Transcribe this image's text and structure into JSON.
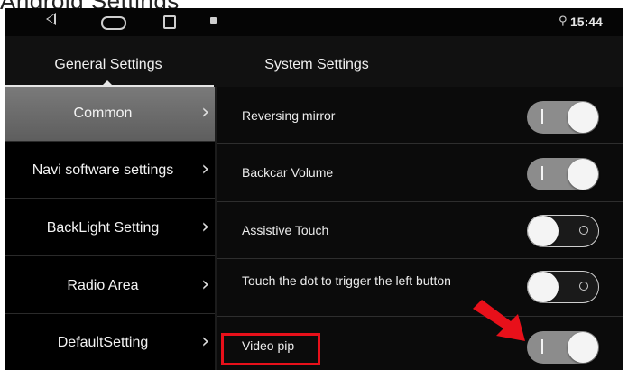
{
  "caption": "Android Settings",
  "status_bar": {
    "time": "15:44",
    "icons": [
      "back-icon",
      "home-icon",
      "recent-apps-icon",
      "notification-icon",
      "location-pin-icon"
    ]
  },
  "tabs": {
    "general": "General Settings",
    "system": "System Settings"
  },
  "sidebar": {
    "items": [
      {
        "label": "Common",
        "active": true
      },
      {
        "label": "Navi software settings",
        "active": false
      },
      {
        "label": "BackLight Setting",
        "active": false
      },
      {
        "label": "Radio Area",
        "active": false
      },
      {
        "label": "DefaultSetting",
        "active": false
      }
    ],
    "chevron": "›"
  },
  "settings": {
    "rows": [
      {
        "label": "Reversing mirror",
        "state": "on"
      },
      {
        "label": "Backcar Volume",
        "state": "on"
      },
      {
        "label": "Assistive Touch",
        "state": "off"
      },
      {
        "label": "Touch the dot to trigger the left button",
        "state": "off"
      },
      {
        "label": "Video pip",
        "state": "on"
      }
    ]
  },
  "annotation": {
    "highlight_color": "#e8101a",
    "arrow_color": "#e8101a"
  }
}
